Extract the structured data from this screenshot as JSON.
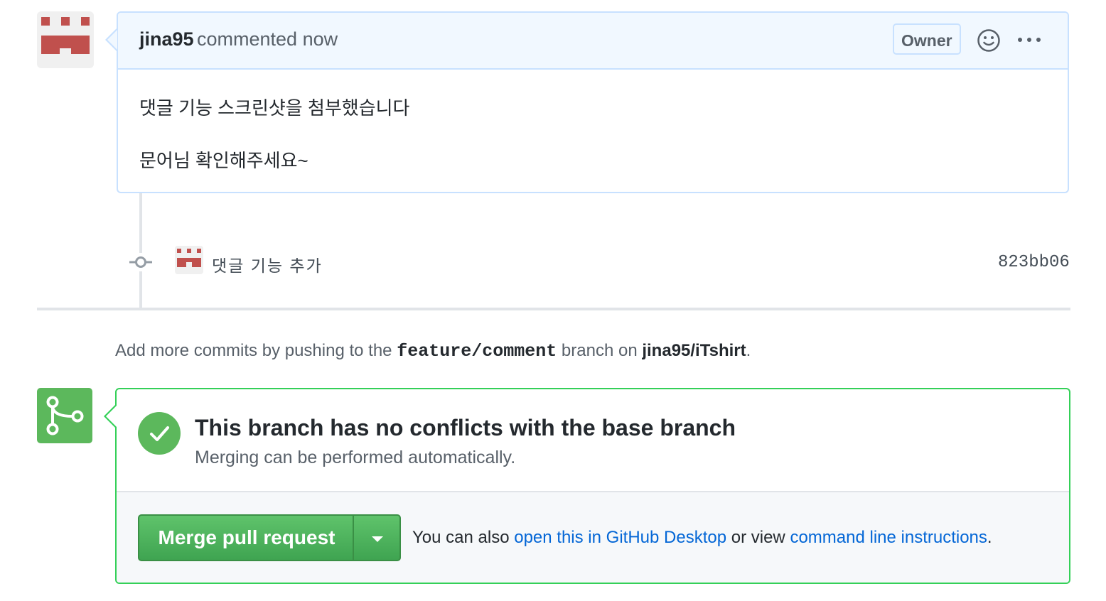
{
  "comment": {
    "author": "jina95",
    "action": "commented now",
    "badge": "Owner",
    "body_lines": [
      "댓글 기능 스크린샷을 첨부했습니다",
      "문어님 확인해주세요~"
    ]
  },
  "commit": {
    "message": "댓글 기능 추가",
    "sha": "823bb06"
  },
  "push_hint": {
    "prefix": "Add more commits by pushing to the",
    "branch": "feature/comment",
    "middle": "branch on",
    "repo": "jina95/iTshirt",
    "suffix": "."
  },
  "merge": {
    "title": "This branch has no conflicts with the base branch",
    "subtitle": "Merging can be performed automatically.",
    "button_label": "Merge pull request",
    "also_prefix": "You can also",
    "desktop_link": "open this in GitHub Desktop",
    "also_middle": "or view",
    "cli_link": "command line instructions",
    "also_suffix": "."
  },
  "colors": {
    "success": "#5cb85c",
    "link": "#0366d6",
    "comment_border": "#c8e1ff",
    "identicon": "#c0504d"
  },
  "icons": [
    "identicon-avatar",
    "smiley-icon",
    "kebab-menu-icon",
    "git-commit-icon",
    "git-merge-icon",
    "check-icon",
    "triangle-down-icon"
  ]
}
